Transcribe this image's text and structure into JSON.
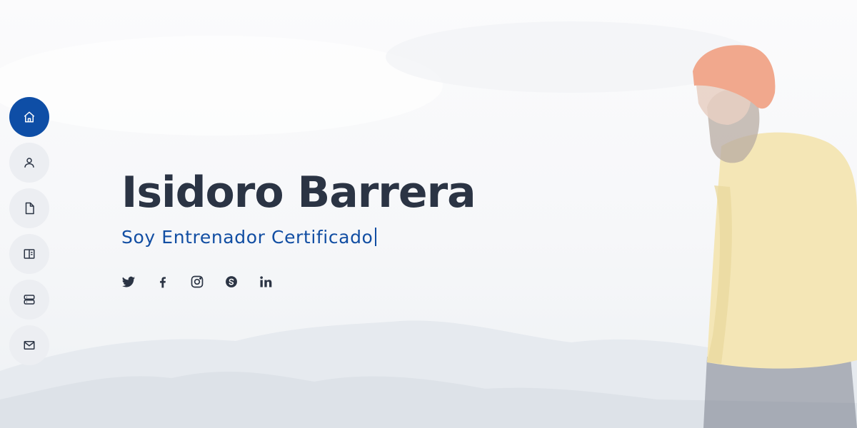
{
  "profile": {
    "name": "Isidoro Barrera",
    "tagline": "Soy Entrenador Certificado"
  },
  "nav": {
    "items": [
      {
        "icon": "home-icon",
        "active": true
      },
      {
        "icon": "user-icon",
        "active": false
      },
      {
        "icon": "file-icon",
        "active": false
      },
      {
        "icon": "book-icon",
        "active": false
      },
      {
        "icon": "server-icon",
        "active": false
      },
      {
        "icon": "mail-icon",
        "active": false
      }
    ]
  },
  "socials": [
    "twitter-icon",
    "facebook-icon",
    "instagram-icon",
    "skype-icon",
    "linkedin-icon"
  ],
  "colors": {
    "accent": "#0e4ea6",
    "name_text": "#2b3444",
    "nav_bg": "#eceef2"
  }
}
